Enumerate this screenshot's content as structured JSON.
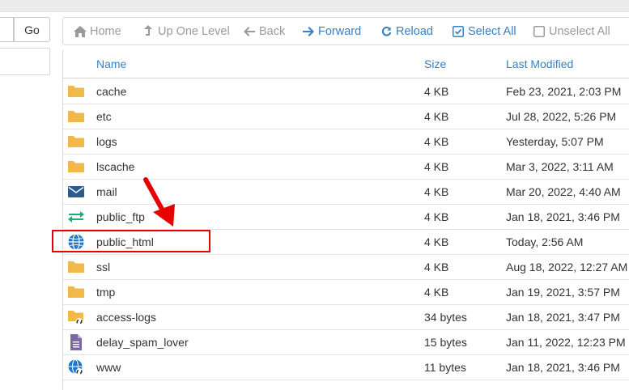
{
  "left_panel": {
    "go_label": "Go"
  },
  "toolbar": {
    "home": "Home",
    "up_one_level": "Up One Level",
    "back": "Back",
    "forward": "Forward",
    "reload": "Reload",
    "select_all": "Select All",
    "unselect_all": "Unselect All"
  },
  "table": {
    "headers": {
      "name": "Name",
      "size": "Size",
      "modified": "Last Modified"
    },
    "rows": [
      {
        "icon": "folder-icon",
        "name": "cache",
        "size": "4 KB",
        "modified": "Feb 23, 2021, 2:03 PM"
      },
      {
        "icon": "folder-icon",
        "name": "etc",
        "size": "4 KB",
        "modified": "Jul 28, 2022, 5:26 PM"
      },
      {
        "icon": "folder-icon",
        "name": "logs",
        "size": "4 KB",
        "modified": "Yesterday, 5:07 PM"
      },
      {
        "icon": "folder-icon",
        "name": "lscache",
        "size": "4 KB",
        "modified": "Mar 3, 2022, 3:11 AM"
      },
      {
        "icon": "mail-icon",
        "name": "mail",
        "size": "4 KB",
        "modified": "Mar 20, 2022, 4:40 AM"
      },
      {
        "icon": "ftp-exchange-icon",
        "name": "public_ftp",
        "size": "4 KB",
        "modified": "Jan 18, 2021, 3:46 PM"
      },
      {
        "icon": "globe-icon",
        "name": "public_html",
        "size": "4 KB",
        "modified": "Today, 2:56 AM"
      },
      {
        "icon": "folder-icon",
        "name": "ssl",
        "size": "4 KB",
        "modified": "Aug 18, 2022, 12:27 AM"
      },
      {
        "icon": "folder-icon",
        "name": "tmp",
        "size": "4 KB",
        "modified": "Jan 19, 2021, 3:57 PM"
      },
      {
        "icon": "folder-link-icon",
        "name": "access-logs",
        "size": "34 bytes",
        "modified": "Jan 18, 2021, 3:47 PM"
      },
      {
        "icon": "file-icon",
        "name": "delay_spam_lover",
        "size": "15 bytes",
        "modified": "Jan 11, 2022, 12:23 PM"
      },
      {
        "icon": "globe-link-icon",
        "name": "www",
        "size": "11 bytes",
        "modified": "Jan 18, 2021, 3:46 PM"
      }
    ]
  },
  "colors": {
    "link_blue": "#3a7fc1",
    "folder": "#f0b94a",
    "mail": "#2c5a8c",
    "ftp": "#25a77b",
    "globe": "#1f78c8",
    "file": "#7a6aa3",
    "annotation_red": "#e60000",
    "disabled_gray": "#9a9a9a"
  }
}
